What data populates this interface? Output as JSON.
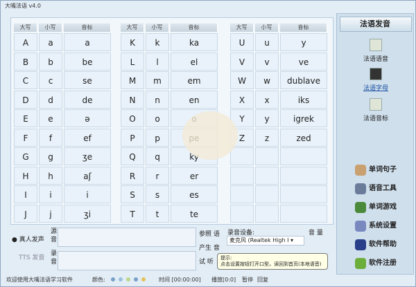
{
  "title": "大嘴法语 v4.0",
  "table": {
    "headers": [
      "大写",
      "小写",
      "音标"
    ],
    "groups": [
      [
        [
          "A",
          "a",
          "a"
        ],
        [
          "B",
          "b",
          "be"
        ],
        [
          "C",
          "c",
          "se"
        ],
        [
          "D",
          "d",
          "de"
        ],
        [
          "E",
          "e",
          "ə"
        ],
        [
          "F",
          "f",
          "ef"
        ],
        [
          "G",
          "g",
          "ʒe"
        ],
        [
          "H",
          "h",
          "aʃ"
        ],
        [
          "I",
          "i",
          "i"
        ],
        [
          "J",
          "j",
          "ʒi"
        ]
      ],
      [
        [
          "K",
          "k",
          "ka"
        ],
        [
          "L",
          "l",
          "el"
        ],
        [
          "M",
          "m",
          "em"
        ],
        [
          "N",
          "n",
          "en"
        ],
        [
          "O",
          "o",
          "o"
        ],
        [
          "P",
          "p",
          "pe"
        ],
        [
          "Q",
          "q",
          "ky"
        ],
        [
          "R",
          "r",
          "er"
        ],
        [
          "S",
          "s",
          "es"
        ],
        [
          "T",
          "t",
          "te"
        ]
      ],
      [
        [
          "U",
          "u",
          "y"
        ],
        [
          "V",
          "v",
          "ve"
        ],
        [
          "W",
          "w",
          "dublave"
        ],
        [
          "X",
          "x",
          "iks"
        ],
        [
          "Y",
          "y",
          "igrek"
        ],
        [
          "Z",
          "z",
          "zed"
        ],
        [
          "",
          "",
          ""
        ],
        [
          "",
          "",
          ""
        ],
        [
          "",
          "",
          ""
        ],
        [
          "",
          "",
          ""
        ]
      ]
    ]
  },
  "sidebar": {
    "header": "法语发音",
    "subitems": [
      "法语语音",
      "法语字母",
      "法语音标"
    ],
    "nav": [
      "单词句子",
      "语音工具",
      "单词游戏",
      "系统设置",
      "软件帮助",
      "软件注册"
    ]
  },
  "bottom": {
    "real_voice": "真人发声",
    "tts": "TTS 发音",
    "source_label": "源音",
    "record_label": "录音",
    "btn_ref": "参照 语",
    "btn_gen": "产生 音",
    "btn_listen": "试 听",
    "device_label": "录音设备:",
    "volume_label": "音 量",
    "device_value": "麦克风 (Realtek High I"
  },
  "tooltip": {
    "title": "提示:",
    "text": "点击设置按钮打开口型，读回到首页(本地语音)"
  },
  "status": {
    "welcome": "欢迎使用大嘴法语学习软件",
    "color_label": "颜色:",
    "time": "时间 [00:00:00]",
    "play": "播放[0:0]",
    "pause": "暂停",
    "reply": "回复"
  },
  "colors": {
    "dots": [
      "#7aa0c8",
      "#9bc1e0",
      "#bcd88a",
      "#7aa0c8",
      "#e4c25a"
    ]
  }
}
